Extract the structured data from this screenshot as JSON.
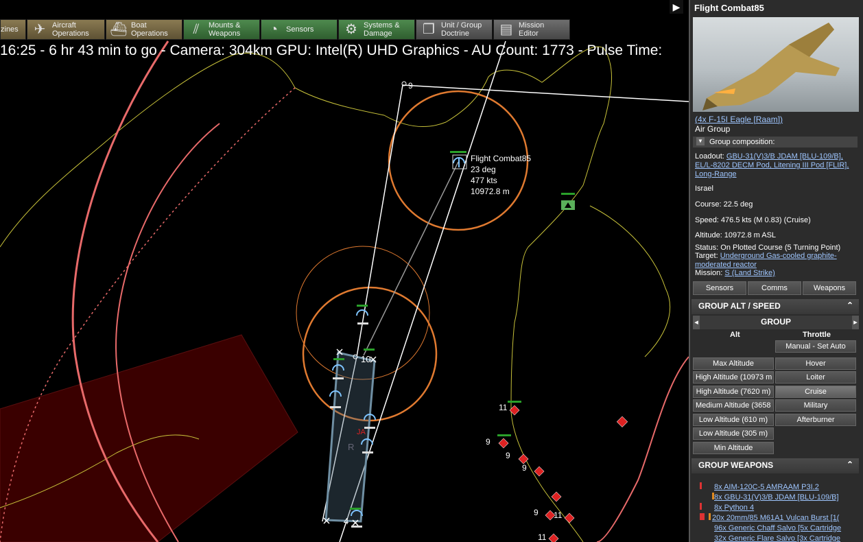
{
  "toolbar": {
    "items": [
      {
        "label": "zines",
        "icon": "magazines-icon"
      },
      {
        "label": "Aircraft\nOperations",
        "icon": "aircraft-icon"
      },
      {
        "label": "Boat\nOperations",
        "icon": "boat-icon"
      },
      {
        "label": "Mounts &\nWeapons",
        "icon": "mounts-icon"
      },
      {
        "label": "Sensors",
        "icon": "sensors-icon"
      },
      {
        "label": "Systems &\nDamage",
        "icon": "gear-icon"
      },
      {
        "label": "Unit / Group\nDoctrine",
        "icon": "doctrine-icon"
      },
      {
        "label": "Mission\nEditor",
        "icon": "mission-editor-icon"
      }
    ]
  },
  "status_line": "16:25 - 6 hr 43 min to go - Camera: 304km GPU: Intel(R) UHD Graphics - AU Count: 1773 - Pulse Time:",
  "map": {
    "unit_label": "Flight Combat85",
    "unit_course": "23 deg",
    "unit_speed": "477 kts",
    "unit_altitude": "10972.8 m",
    "waypoint_9": "9",
    "waypoint_10": "10",
    "waypoint_4": "4",
    "red_label": "JA",
    "r_label": "R",
    "enemy_labels": [
      "11",
      "9",
      "9",
      "9",
      "9",
      "11",
      "11"
    ]
  },
  "panel": {
    "title": "Flight Combat85",
    "unit_type": "(4x F-15I Eagle [Raam])",
    "group_kind": "Air Group",
    "group_composition": "Group composition:",
    "loadout_label": "Loadout:",
    "loadout_value": "GBU-31(V)3/B JDAM [BLU-109/B], EL/L-8202 DECM Pod, Litening III Pod [FLIR], Long-Range",
    "country": "Israel",
    "course": "Course: 22.5 deg",
    "speed": "Speed: 476.5 kts (M 0.83) (Cruise)",
    "altitude": "Altitude: 10972.8 m ASL",
    "status": "Status: On Plotted Course (5 Turning Point)",
    "target_label": "Target:",
    "target_value": "Underground Gas-cooled graphite-moderated reactor",
    "mission_label": "Mission:",
    "mission_value": "S (Land Strike)",
    "tabs": [
      "Sensors",
      "Comms",
      "Weapons"
    ],
    "alt_speed_header": "GROUP ALT / SPEED",
    "group_label": "GROUP",
    "alt_col": "Alt",
    "throttle_col": "Throttle",
    "manual_btn": "Manual - Set Auto",
    "alt_buttons": [
      "Max Altitude",
      "High Altitude (10973 m",
      "High Altitude (7620 m)",
      "Medium Altitude (3658",
      "Low Altitude (610 m)",
      "Low Altitude (305 m)",
      "Min Altitude"
    ],
    "throttle_buttons": [
      "Hover",
      "Loiter",
      "Cruise",
      "Military",
      "Afterburner"
    ],
    "weapons_header": "GROUP WEAPONS",
    "weapons": [
      "8x AIM-120C-5 AMRAAM P3I.2",
      "8x GBU-31(V)3/B JDAM [BLU-109/B]",
      "8x Python 4",
      "20x 20mm/85 M61A1 Vulcan Burst [1(",
      "96x Generic Chaff Salvo [5x Cartridge",
      "32x Generic Flare Salvo [3x Cartridge"
    ],
    "colors": {
      "link": "#9fc6ff",
      "panel_bg": "#2c2c2c",
      "header_bg": "#3f3f3f"
    }
  }
}
